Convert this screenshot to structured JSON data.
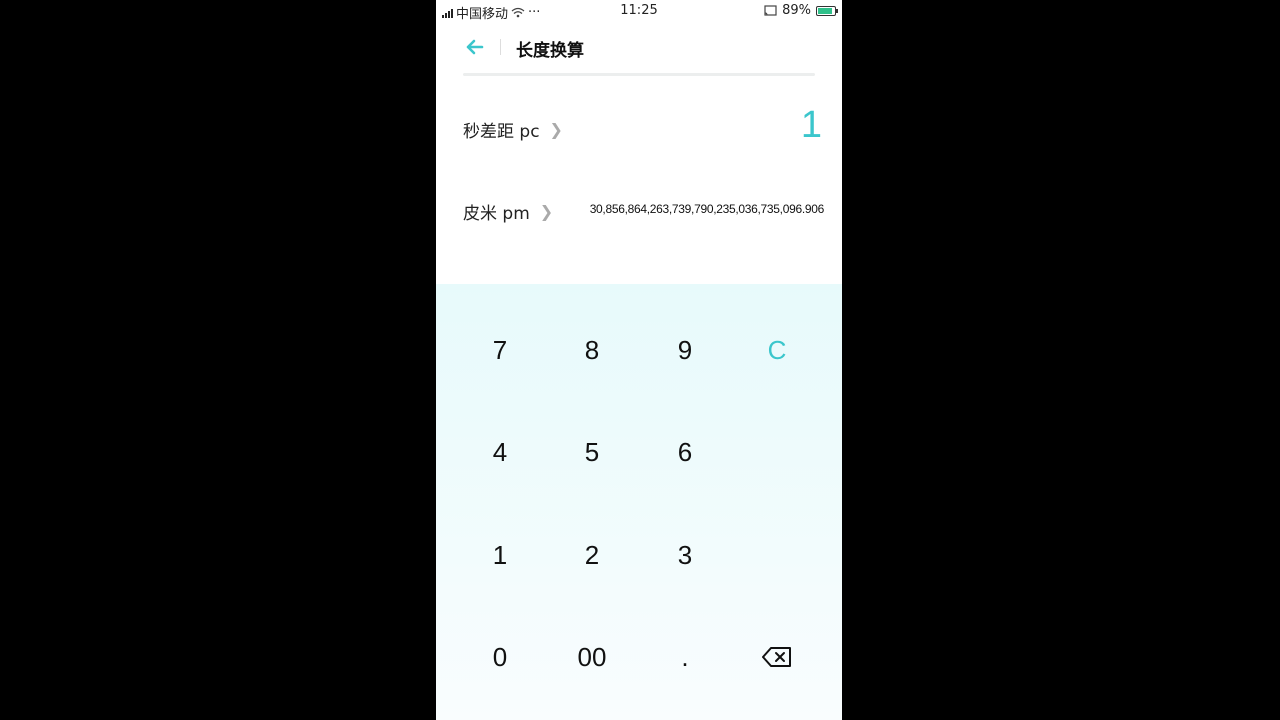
{
  "status_bar": {
    "carrier": "中国移动",
    "time": "11:25",
    "battery": "89%",
    "battery_level": 0.89,
    "more": "···"
  },
  "header": {
    "title": "长度换算",
    "back_icon": "arrow-left-icon"
  },
  "conversion": {
    "from": {
      "unit": "秒差距 pc",
      "value": "1"
    },
    "to": {
      "unit": "皮米 pm",
      "value": "30,856,864,263,739,790,235,036,735,096.906"
    }
  },
  "keypad": {
    "keys": [
      "7",
      "8",
      "9",
      "C",
      "4",
      "5",
      "6",
      "1",
      "2",
      "3",
      "0",
      "00",
      "."
    ],
    "backspace_icon": "backspace-icon"
  },
  "colors": {
    "accent": "#3bc6cc",
    "keypad_bg": "#e7fafb"
  }
}
